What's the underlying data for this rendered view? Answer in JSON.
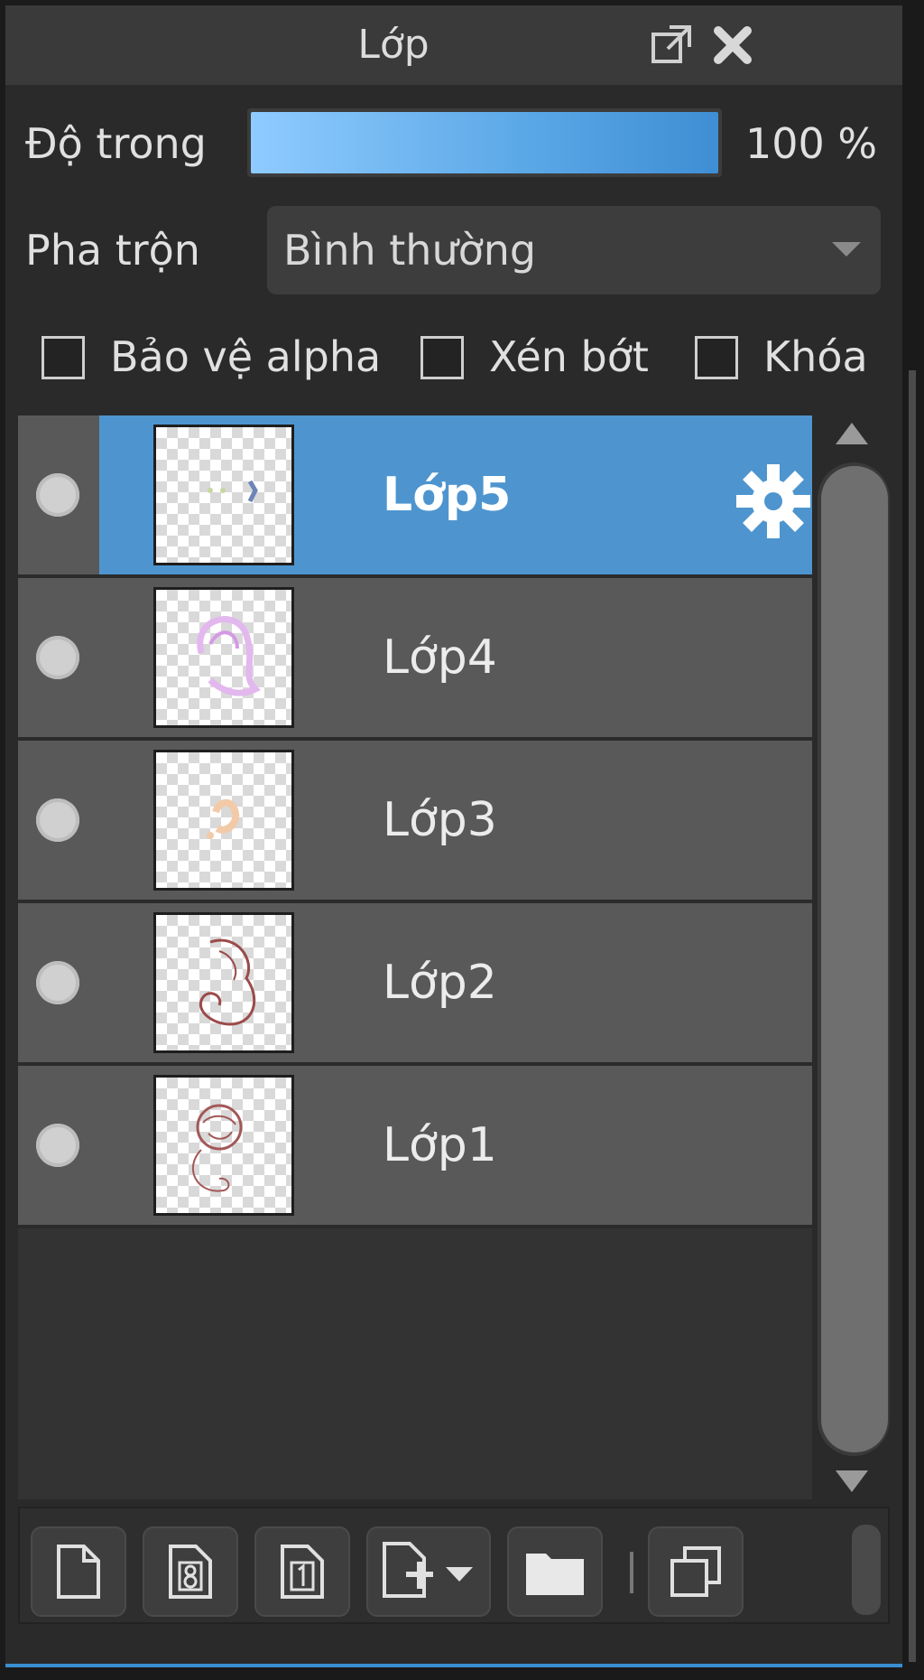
{
  "panel": {
    "title": "Lớp",
    "title_buttons": [
      "popout-icon",
      "close-icon"
    ]
  },
  "opacity": {
    "label": "Độ trong",
    "value_percent": 100,
    "value_text": "100 %"
  },
  "blend": {
    "label": "Pha trộn",
    "selected": "Bình thường"
  },
  "checkboxes": [
    {
      "label": "Bảo vệ alpha",
      "checked": false
    },
    {
      "label": "Xén bớt",
      "checked": false
    },
    {
      "label": "Khóa",
      "checked": false
    }
  ],
  "layers": [
    {
      "name": "Lớp5",
      "selected": true,
      "visible": true
    },
    {
      "name": "Lớp4",
      "selected": false,
      "visible": true
    },
    {
      "name": "Lớp3",
      "selected": false,
      "visible": true
    },
    {
      "name": "Lớp2",
      "selected": false,
      "visible": true
    },
    {
      "name": "Lớp1",
      "selected": false,
      "visible": true
    }
  ],
  "toolbar": {
    "buttons": [
      "new-layer-icon",
      "new-8bit-layer-icon",
      "new-1bit-layer-icon",
      "add-layer-menu-icon",
      "new-folder-icon",
      "duplicate-layer-icon"
    ]
  },
  "colors": {
    "accent": "#4e95cf",
    "row_bg": "#595959",
    "panel_bg": "#2a2a2a"
  }
}
